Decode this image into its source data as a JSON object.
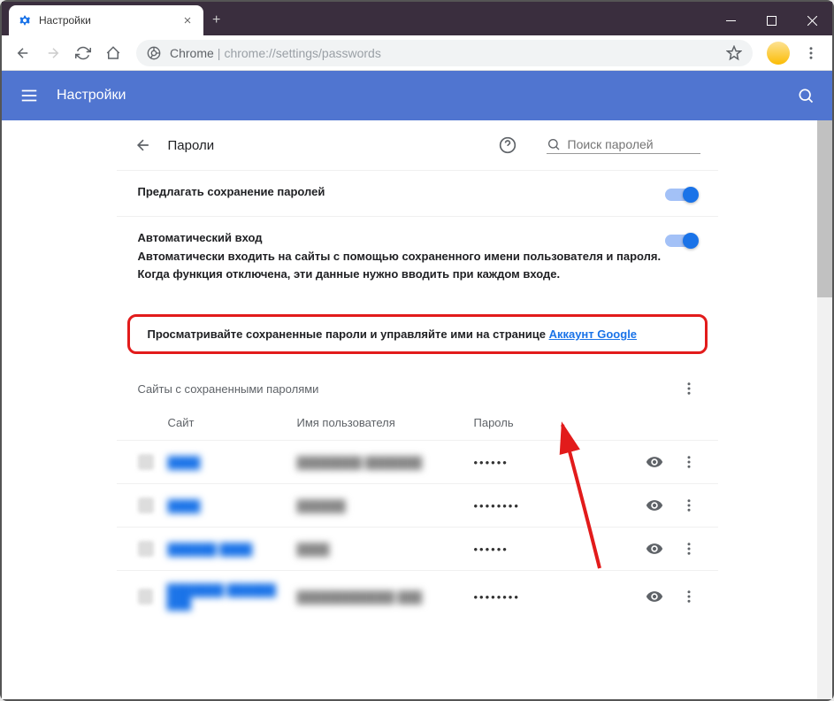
{
  "tab": {
    "title": "Настройки"
  },
  "address": {
    "protocol": "Chrome",
    "path": "chrome://settings/passwords"
  },
  "topbar": {
    "title": "Настройки"
  },
  "page": {
    "back_icon": "arrow-back",
    "title": "Пароли",
    "search_placeholder": "Поиск паролей"
  },
  "settings": {
    "offer_save": {
      "title": "Предлагать сохранение паролей"
    },
    "auto_signin": {
      "title": "Автоматический вход",
      "desc": "Автоматически входить на сайты с помощью сохраненного имени пользователя и пароля. Когда функция отключена, эти данные нужно вводить при каждом входе."
    }
  },
  "highlight": {
    "text": "Просматривайте сохраненные пароли и управляйте ими на странице ",
    "link": "Аккаунт Google"
  },
  "saved": {
    "title": "Сайты с сохраненными паролями",
    "columns": {
      "site": "Сайт",
      "user": "Имя пользователя",
      "pass": "Пароль"
    },
    "rows": [
      {
        "site": "████",
        "user": "████████ ███████",
        "pass": "••••••"
      },
      {
        "site": "████",
        "user": "██████",
        "pass": "••••••••"
      },
      {
        "site": "██████ ████",
        "user": "████",
        "pass": "••••••"
      },
      {
        "site": "███████ ██████ ███",
        "user": "████████████ ███",
        "pass": "••••••••"
      }
    ]
  }
}
